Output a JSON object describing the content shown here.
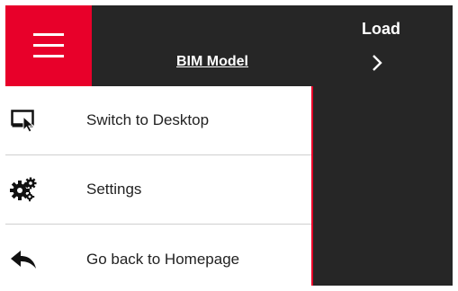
{
  "colors": {
    "accent": "#e8002a",
    "topbar": "#262626",
    "menu_bg": "#ffffff"
  },
  "header": {
    "menu_icon": "hamburger-icon",
    "model_link": "BIM Model",
    "load": {
      "label": "Load",
      "icon": "chevron-right-icon"
    }
  },
  "menu": {
    "items": [
      {
        "label": "Switch to Desktop",
        "icon": "desktop-cursor-icon"
      },
      {
        "label": "Settings",
        "icon": "gears-icon"
      },
      {
        "label": "Go back to Homepage",
        "icon": "back-arrow-icon"
      }
    ]
  }
}
